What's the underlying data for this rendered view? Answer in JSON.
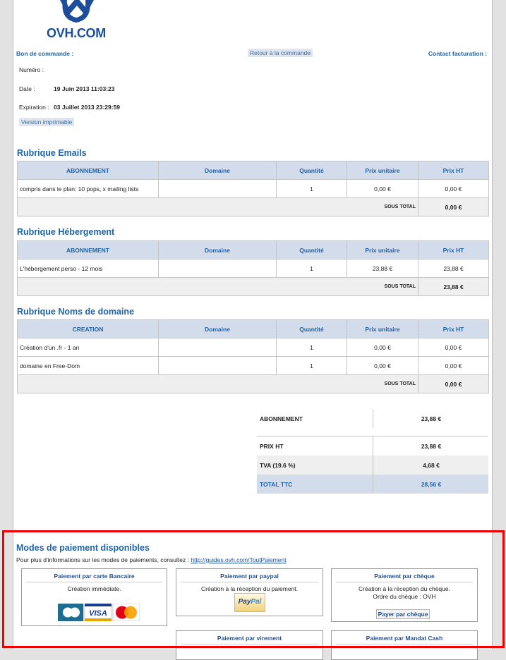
{
  "header": {
    "logo_text": "OVH.COM",
    "order_label": "Bon de commande :",
    "back_label": "Retour à la commande",
    "billing_contact_label": "Contact facturation :",
    "number_label": "Numéro :",
    "number_value": "",
    "date_label": "Date :",
    "date_value": "19 Juin 2013 11:03:23",
    "expiration_label": "Expiration :",
    "expiration_value": "03 Juillet 2013 23:29:59",
    "printable_label": "Version imprimable"
  },
  "sections": [
    {
      "title": "Rubrique Emails",
      "columns": [
        "ABONNEMENT",
        "Domaine",
        "Quantité",
        "Prix unitaire",
        "Prix HT"
      ],
      "rows": [
        {
          "name": "compris dans le plan: 10 pops, x mailing lists",
          "domain": "",
          "qty": "1",
          "unit": "0,00 €",
          "ht": "0,00 €"
        }
      ],
      "subtotal_label": "Sous total",
      "subtotal_value": "0,00 €"
    },
    {
      "title": "Rubrique Hébergement",
      "columns": [
        "ABONNEMENT",
        "Domaine",
        "Quantité",
        "Prix unitaire",
        "Prix HT"
      ],
      "rows": [
        {
          "name": "L'hébergement perso - 12 mois",
          "domain": "",
          "qty": "1",
          "unit": "23,88 €",
          "ht": "23,88 €"
        }
      ],
      "subtotal_label": "Sous total",
      "subtotal_value": "23,88 €"
    },
    {
      "title": "Rubrique Noms de domaine",
      "columns": [
        "CREATION",
        "Domaine",
        "Quantité",
        "Prix unitaire",
        "Prix HT"
      ],
      "rows": [
        {
          "name": "Création d'un .fr - 1 an",
          "domain": "",
          "qty": "1",
          "unit": "0,00 €",
          "ht": "0,00 €"
        },
        {
          "name": "domaine en Free-Dom",
          "domain": "",
          "qty": "1",
          "unit": "0,00 €",
          "ht": "0,00 €"
        }
      ],
      "subtotal_label": "Sous total",
      "subtotal_value": "0,00 €"
    }
  ],
  "totals": {
    "subscription_label": "ABONNEMENT",
    "subscription_value": "23,88 €",
    "price_ht_label": "PRIX HT",
    "price_ht_value": "23,88 €",
    "vat_label": "TVA (19.6 %)",
    "vat_value": "4,68 €",
    "total_label": "TOTAL TTC",
    "total_value": "28,56 €"
  },
  "payment": {
    "title": "Modes de paiement disponibles",
    "info_text": "Pour plus d'informations sur les modes de paiements, consultez :",
    "info_link": "http://guides.ovh.com/ToutPaiement",
    "methods": [
      {
        "title": "Paiement par carte Bancaire",
        "desc": "Création immédiate.",
        "logos": [
          "CB",
          "VISA",
          "MasterCard"
        ]
      },
      {
        "title": "Paiement par paypal",
        "desc": "Création à la réception du paiement.",
        "logo": "PayPal"
      },
      {
        "title": "Paiement par chèque",
        "desc": "Création à la réception du chèque.",
        "desc2": "Ordre du chèque : OVH",
        "button": "Payer par chèque"
      },
      {
        "title": "Paiement par virement"
      },
      {
        "title": "Paiement par Mandat Cash"
      }
    ]
  },
  "colors": {
    "accent_blue": "#1f63a8",
    "header_bg": "#d3dcea",
    "highlight_red": "#ee0000"
  }
}
